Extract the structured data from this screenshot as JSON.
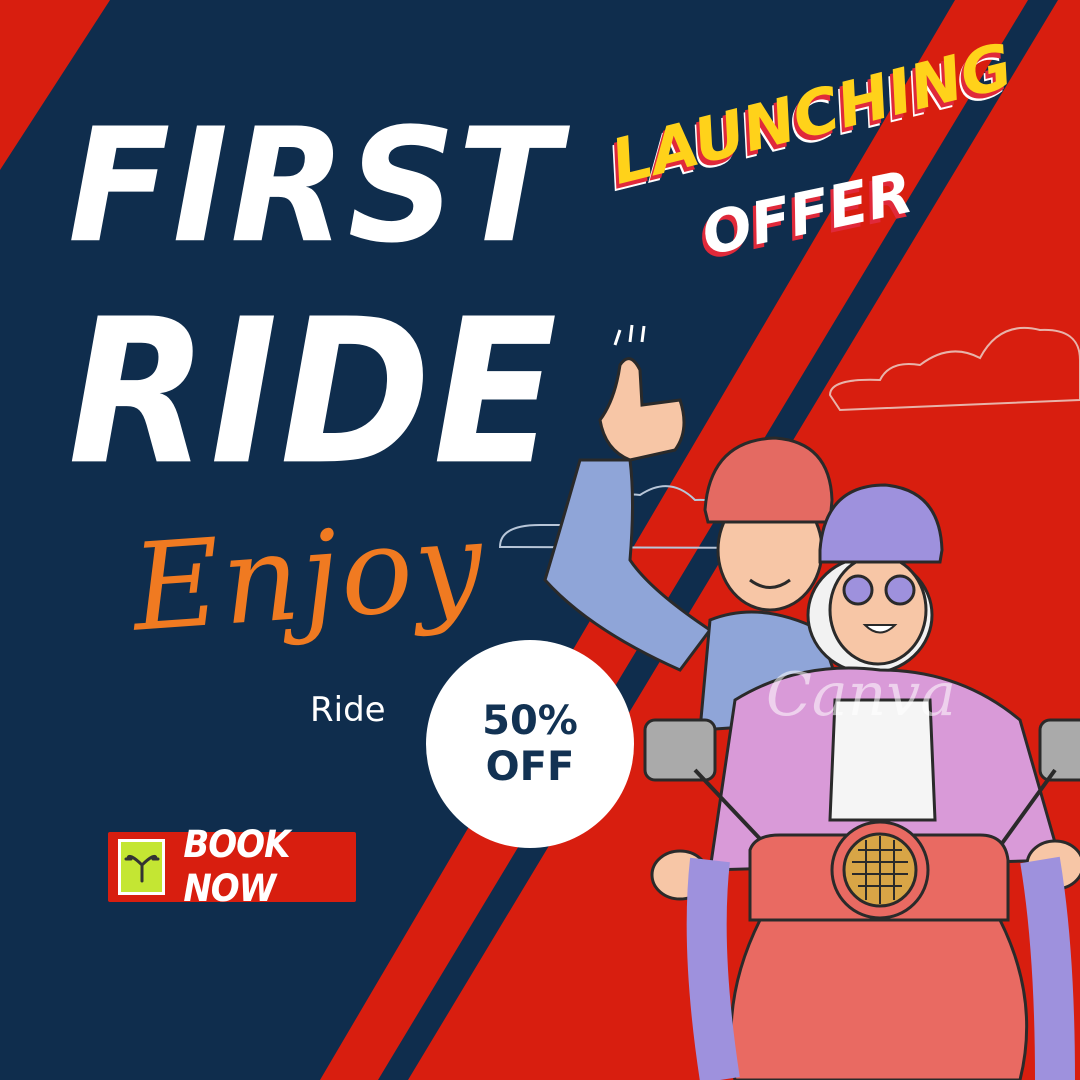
{
  "poster": {
    "title_line_1": "FIRST",
    "title_line_2": "RIDE",
    "tagline_script": "Enjoy",
    "tagline_small": "Ride",
    "badge": {
      "line_1": "LAUNCHING",
      "line_2": "OFFER"
    },
    "discount": {
      "line_1": "50%",
      "line_2": "OFF"
    },
    "cta": {
      "label": "BOOK NOW",
      "logo_icon": "scooter-handlebar-icon"
    },
    "watermark": "Canva"
  },
  "colors": {
    "navy": "#0f2d4d",
    "red": "#d81e0f",
    "orange_script": "#f07a21",
    "badge_yellow": "#ffd21a",
    "badge_shadow_red": "#e0293a",
    "logo_green": "#c4e633",
    "white": "#ffffff"
  }
}
